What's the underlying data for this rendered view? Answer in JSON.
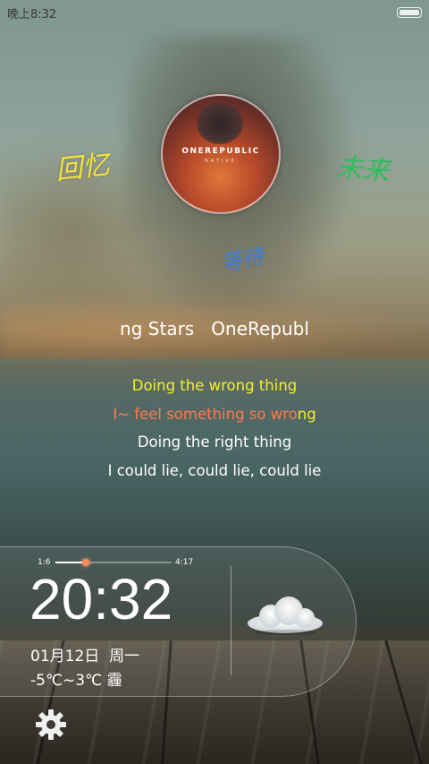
{
  "status_bar": {
    "time": "晚上8:32"
  },
  "album": {
    "band_text": "ONEREPUBLIC",
    "sub_text": "NATIVE"
  },
  "handwriting": {
    "memory": "回忆",
    "future": "未来",
    "wait": "等待"
  },
  "now_playing": {
    "marquee": "ng Stars   OneRepubl"
  },
  "lyrics": {
    "line1": "Doing the wrong thing",
    "line2_sung": "I~ feel something so wro",
    "line2_unsung": "ng",
    "line3": "Doing the right thing",
    "line4": "I could lie, could lie, could lie"
  },
  "player": {
    "elapsed": "1:6",
    "duration": "4:17",
    "progress": 0.26
  },
  "clock": {
    "time": "20:32"
  },
  "date": {
    "date": "01月12日",
    "weekday": "周一"
  },
  "weather": {
    "range": "-5℃~3℃",
    "condition": "霾",
    "icon": "cloud-icon"
  },
  "settings": {
    "icon": "gear-icon"
  },
  "colors": {
    "lyric_current": "#f3ef2f",
    "lyric_sung": "#ff7a4a",
    "progress_knob": "#ff8a5a"
  }
}
